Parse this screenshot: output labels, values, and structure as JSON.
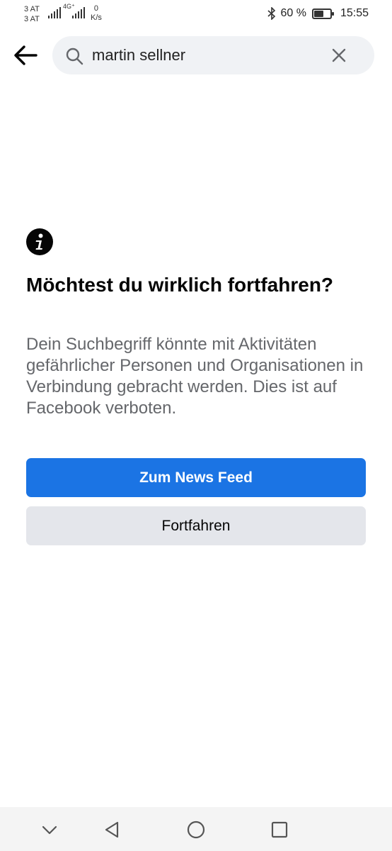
{
  "status_bar": {
    "carrier_top": "3 AT",
    "carrier_bottom": "3 AT",
    "network": "4G⁺",
    "speed_value": "0",
    "speed_unit": "K/s",
    "battery_percent": "60 %",
    "battery_level": 0.6,
    "time": "15:55"
  },
  "search": {
    "query": "martin sellner"
  },
  "warning": {
    "title": "Möchtest du wirklich fortfahren?",
    "body": "Dein Suchbegriff könnte mit Aktivitäten gefährlicher Personen und Organisationen in Verbindung gebracht werden. Dies ist auf Facebook verboten.",
    "primary_button": "Zum News Feed",
    "secondary_button": "Fortfahren"
  },
  "colors": {
    "primary": "#1b74e4",
    "secondary_bg": "#e4e6eb",
    "body_text": "#65676b"
  },
  "icons": {
    "back": "arrow-left-icon",
    "search": "search-icon",
    "clear": "close-icon",
    "info": "info-icon",
    "nav_down": "chevron-down-icon",
    "nav_back": "triangle-back-icon",
    "nav_home": "circle-home-icon",
    "nav_recents": "square-recents-icon"
  }
}
